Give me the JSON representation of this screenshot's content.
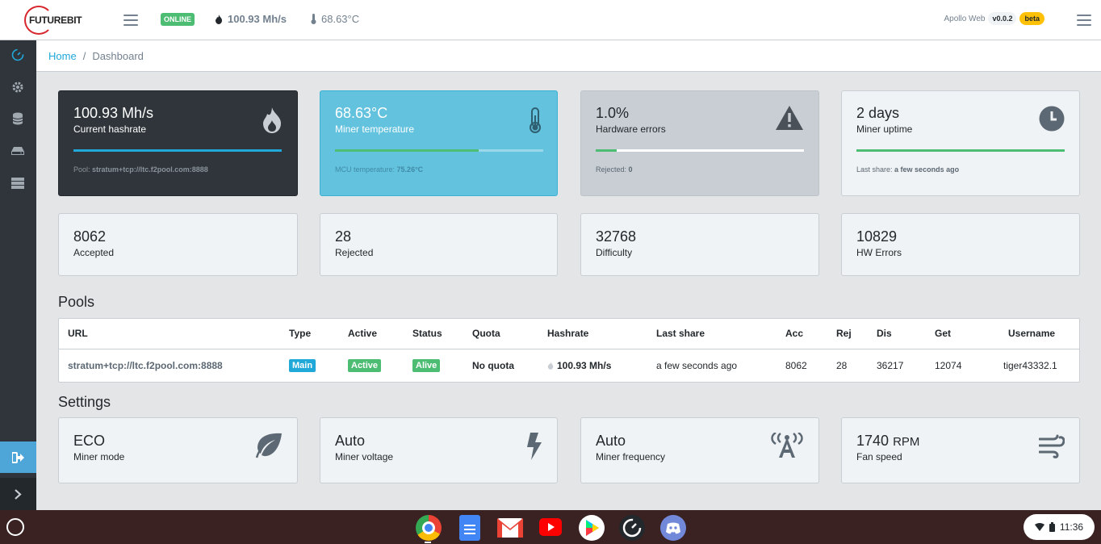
{
  "header": {
    "logo_text": "FUTUREBIT",
    "status_badge": "ONLINE",
    "hashrate": "100.93 Mh/s",
    "temperature": "68.63°C",
    "app_name": "Apollo Web",
    "version": "v0.0.2",
    "channel": "beta"
  },
  "breadcrumb": {
    "home": "Home",
    "separator": "/",
    "current": "Dashboard"
  },
  "top_cards": [
    {
      "value": "100.93 Mh/s",
      "label": "Current hashrate",
      "foot_label": "Pool:",
      "foot_value": "stratum+tcp://ltc.f2pool.com:8888",
      "icon": "fire-icon",
      "progress": 1.0
    },
    {
      "value": "68.63°C",
      "label": "Miner temperature",
      "foot_label": "MCU temperature:",
      "foot_value": "75.26°C",
      "icon": "thermometer-icon",
      "progress": 0.69
    },
    {
      "value": "1.0%",
      "label": "Hardware errors",
      "foot_label": "Rejected:",
      "foot_value": "0",
      "icon": "warning-icon",
      "progress": 0.1
    },
    {
      "value": "2 days",
      "label": "Miner uptime",
      "foot_label": "Last share:",
      "foot_value": "a few seconds ago",
      "icon": "clock-icon",
      "progress": 1.0
    }
  ],
  "stats": [
    {
      "value": "8062",
      "label": "Accepted"
    },
    {
      "value": "28",
      "label": "Rejected"
    },
    {
      "value": "32768",
      "label": "Difficulty"
    },
    {
      "value": "10829",
      "label": "HW Errors"
    }
  ],
  "pools": {
    "title": "Pools",
    "columns": [
      "URL",
      "Type",
      "Active",
      "Status",
      "Quota",
      "Hashrate",
      "Last share",
      "Acc",
      "Rej",
      "Dis",
      "Get",
      "Username"
    ],
    "rows": [
      {
        "url": "stratum+tcp://ltc.f2pool.com:8888",
        "type": "Main",
        "active": "Active",
        "status": "Alive",
        "quota": "No quota",
        "hashrate": "100.93 Mh/s",
        "last_share": "a few seconds ago",
        "acc": "8062",
        "rej": "28",
        "dis": "36217",
        "get": "12074",
        "username": "tiger43332.1"
      }
    ]
  },
  "settings": {
    "title": "Settings",
    "cards": [
      {
        "value": "ECO",
        "label": "Miner mode",
        "icon": "leaf-icon"
      },
      {
        "value": "Auto",
        "label": "Miner voltage",
        "icon": "bolt-icon"
      },
      {
        "value": "Auto",
        "label": "Miner frequency",
        "icon": "broadcast-tower-icon"
      },
      {
        "value": "1740",
        "unit": "RPM",
        "label": "Fan speed",
        "icon": "wind-icon"
      }
    ]
  },
  "taskbar": {
    "time": "11:36",
    "apps": [
      "chrome-icon",
      "docs-icon",
      "gmail-icon",
      "youtube-icon",
      "play-store-icon",
      "speedometer-icon",
      "discord-icon"
    ]
  },
  "colors": {
    "accent": "#20a8d8",
    "dark_card": "#2f353a",
    "info_card": "#63c2de",
    "gray_card": "#c8ced3",
    "success": "#4dbd74",
    "primary": "#20a8d8",
    "warning": "#ffc107"
  }
}
